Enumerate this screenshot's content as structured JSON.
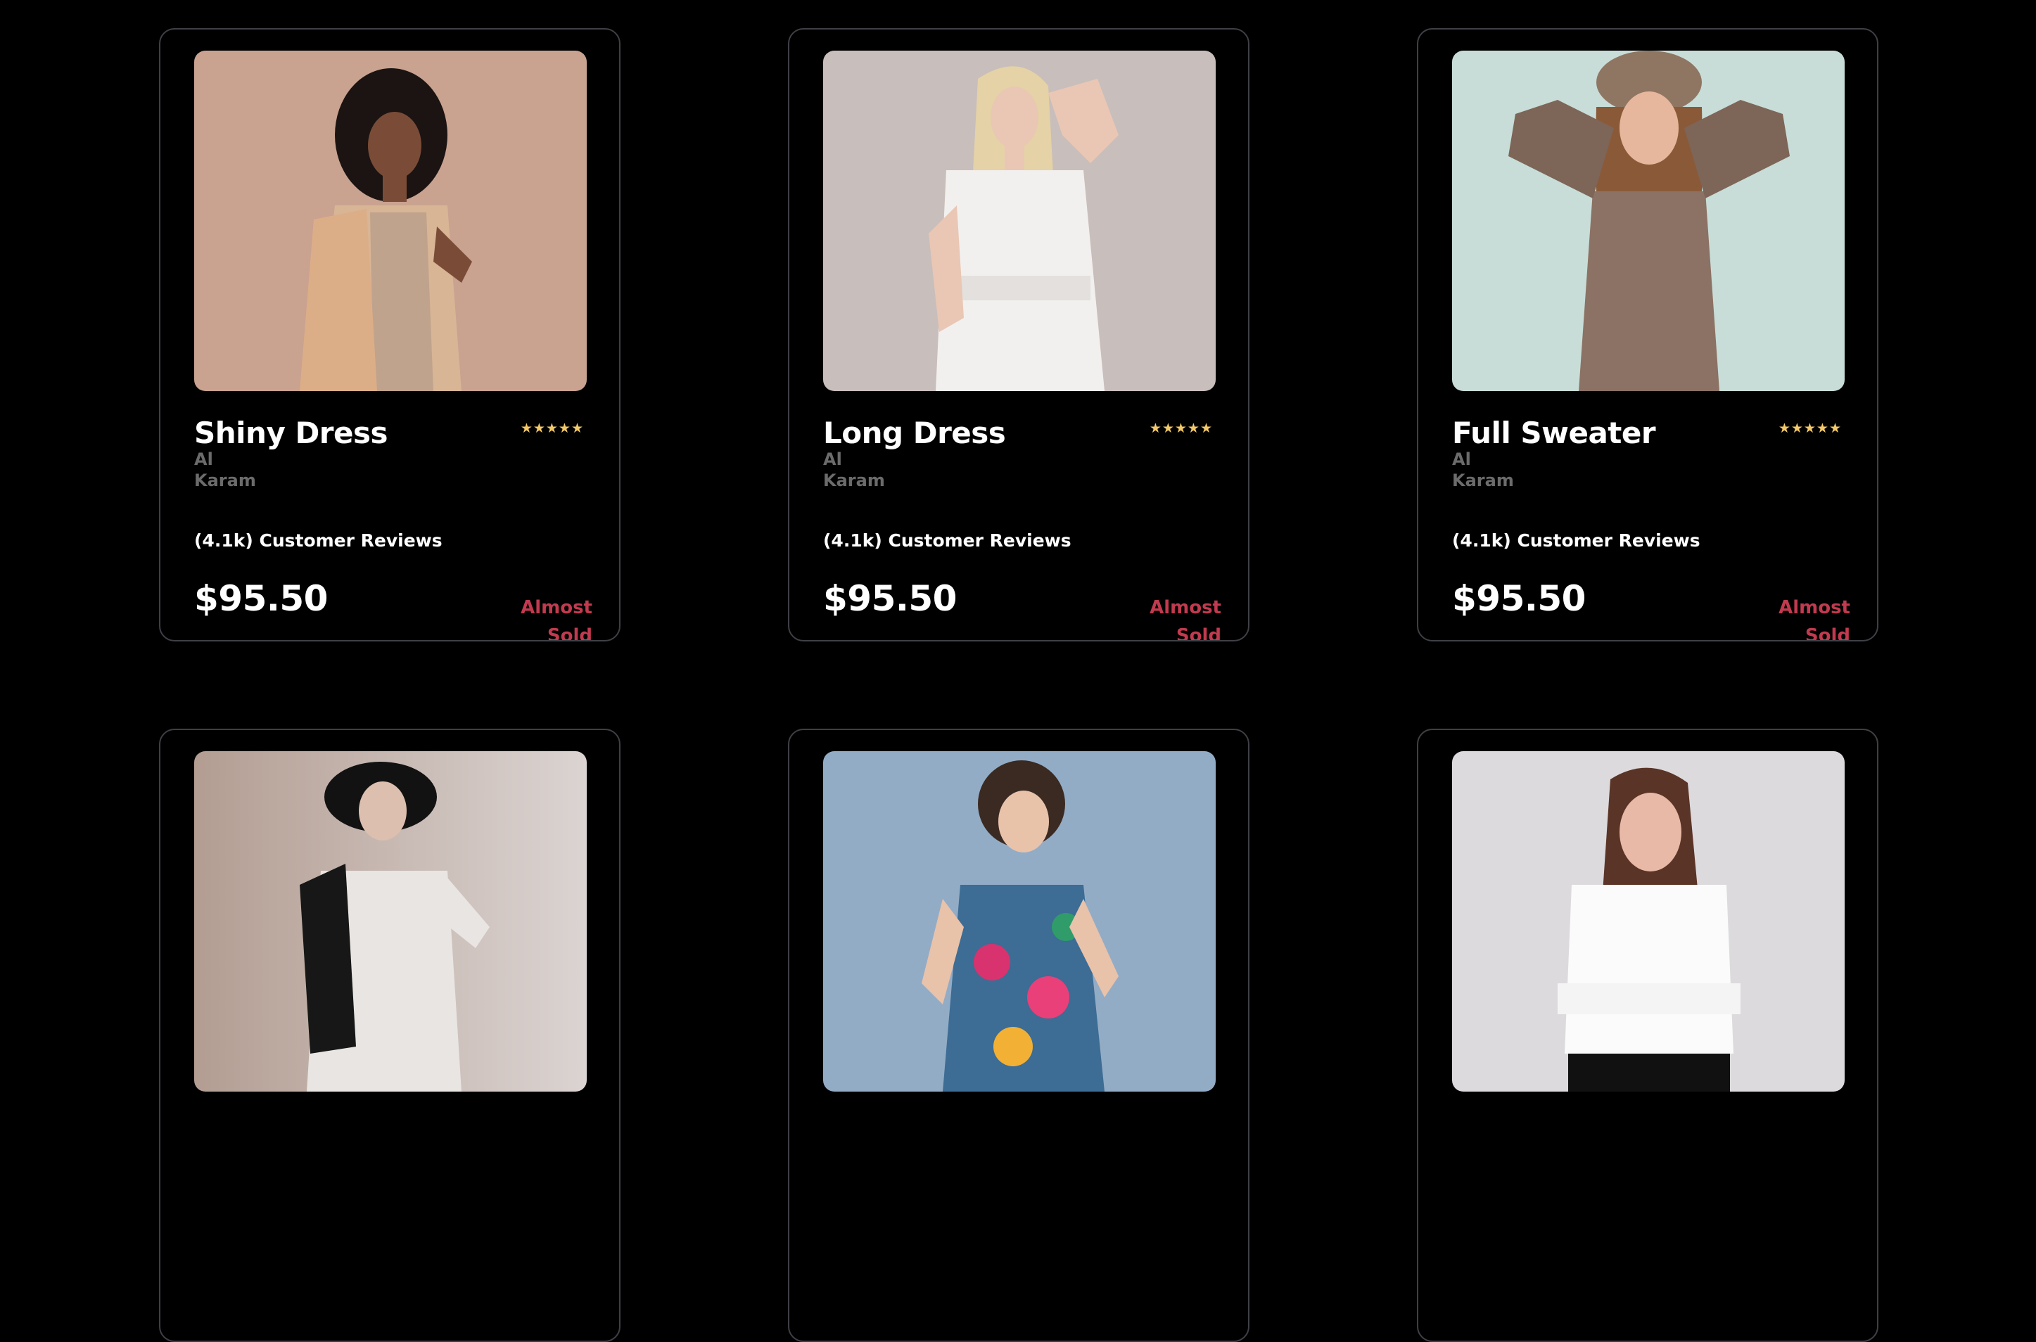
{
  "accent": {
    "price": "#ffffff",
    "stock_status": "#c23a4f",
    "stars": "#f3c969"
  },
  "products": [
    {
      "name": "Shiny Dress",
      "brand": "Al Karam",
      "rating": "★★★★★",
      "reviews": "(4.1k) Customer Reviews",
      "price": "$95.50",
      "status": "Almost Sold Out"
    },
    {
      "name": "Long Dress",
      "brand": "Al Karam",
      "rating": "★★★★★",
      "reviews": "(4.1k) Customer Reviews",
      "price": "$95.50",
      "status": "Almost Sold Out"
    },
    {
      "name": "Full Sweater",
      "brand": "Al Karam",
      "rating": "★★★★★",
      "reviews": "(4.1k) Customer Reviews",
      "price": "$95.50",
      "status": "Almost Sold Out"
    },
    {
      "photo": "woman-in-hat-and-leather-jacket-photo"
    },
    {
      "photo": "woman-in-floral-dress-photo"
    },
    {
      "photo": "woman-in-white-sweater-photo"
    }
  ]
}
